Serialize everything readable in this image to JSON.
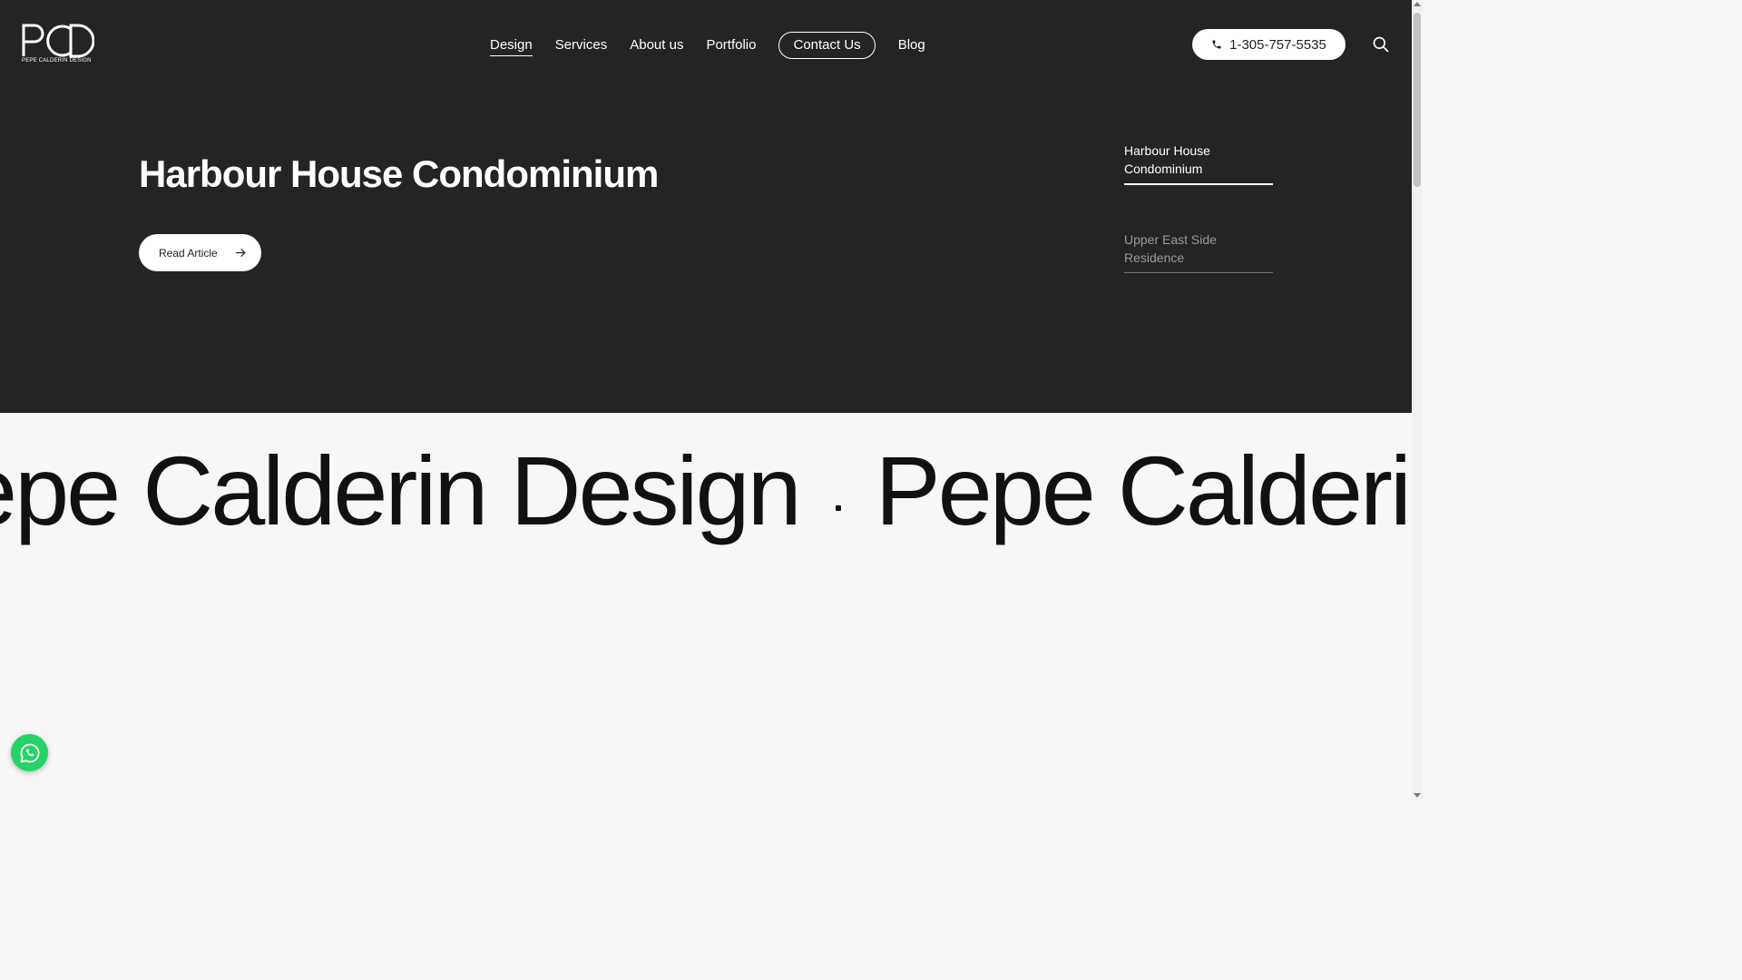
{
  "brand": {
    "logo_mark": "PCD",
    "logo_text": "PEPE CALDERIN DESIGN"
  },
  "nav": {
    "items": [
      {
        "label": "Design",
        "active": true
      },
      {
        "label": "Services"
      },
      {
        "label": "About us"
      },
      {
        "label": "Portfolio"
      },
      {
        "label": "Contact Us"
      },
      {
        "label": "Blog"
      }
    ]
  },
  "header": {
    "phone": "1-305-757-5535",
    "search_icon": "search-icon"
  },
  "hero": {
    "title": "Harbour House Condominium",
    "cta_label": "Read Article",
    "side_items": [
      {
        "label": "Harbour House Condominium",
        "active": true
      },
      {
        "label": "Upper East Side Residence",
        "active": false
      }
    ]
  },
  "marquee": {
    "text_1": "Pepe Calderin Design",
    "text_2": "Pepe Calderin Design"
  },
  "floating": {
    "whatsapp_icon": "whatsapp-icon"
  },
  "colors": {
    "hero_bg": "#242424",
    "page_bg": "#f7f7f7",
    "whatsapp": "#25d366"
  }
}
